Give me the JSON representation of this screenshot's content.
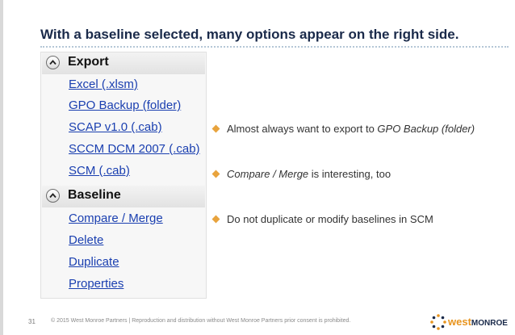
{
  "slide": {
    "title": "With a baseline selected, many options appear on the right side.",
    "page_number": "31",
    "copyright": "© 2015 West Monroe Partners  |  Reproduction and distribution without West Monroe Partners prior consent is prohibited."
  },
  "panel": {
    "export": {
      "header": "Export",
      "links": [
        "Excel (.xlsm)",
        "GPO Backup (folder)",
        "SCAP v1.0 (.cab)",
        "SCCM DCM 2007 (.cab)",
        "SCM (.cab)"
      ]
    },
    "baseline": {
      "header": "Baseline",
      "links": [
        "Compare / Merge",
        "Delete",
        "Duplicate",
        "Properties"
      ]
    }
  },
  "bullets": [
    {
      "before": "Almost always want to export to ",
      "em": "GPO Backup (folder)",
      "after": ""
    },
    {
      "before": "",
      "em": "Compare / Merge",
      "after": " is interesting, too"
    },
    {
      "before": "Do not duplicate or modify baselines in SCM",
      "em": "",
      "after": ""
    }
  ],
  "logo": {
    "west": "west",
    "monroe": "MONROE"
  },
  "colors": {
    "accent": "#e8a33d",
    "link": "#1a3fb0",
    "title": "#1a2a4a"
  },
  "icons": {
    "collapse": "chevron-up-icon",
    "bullet": "diamond-bullet-icon"
  }
}
